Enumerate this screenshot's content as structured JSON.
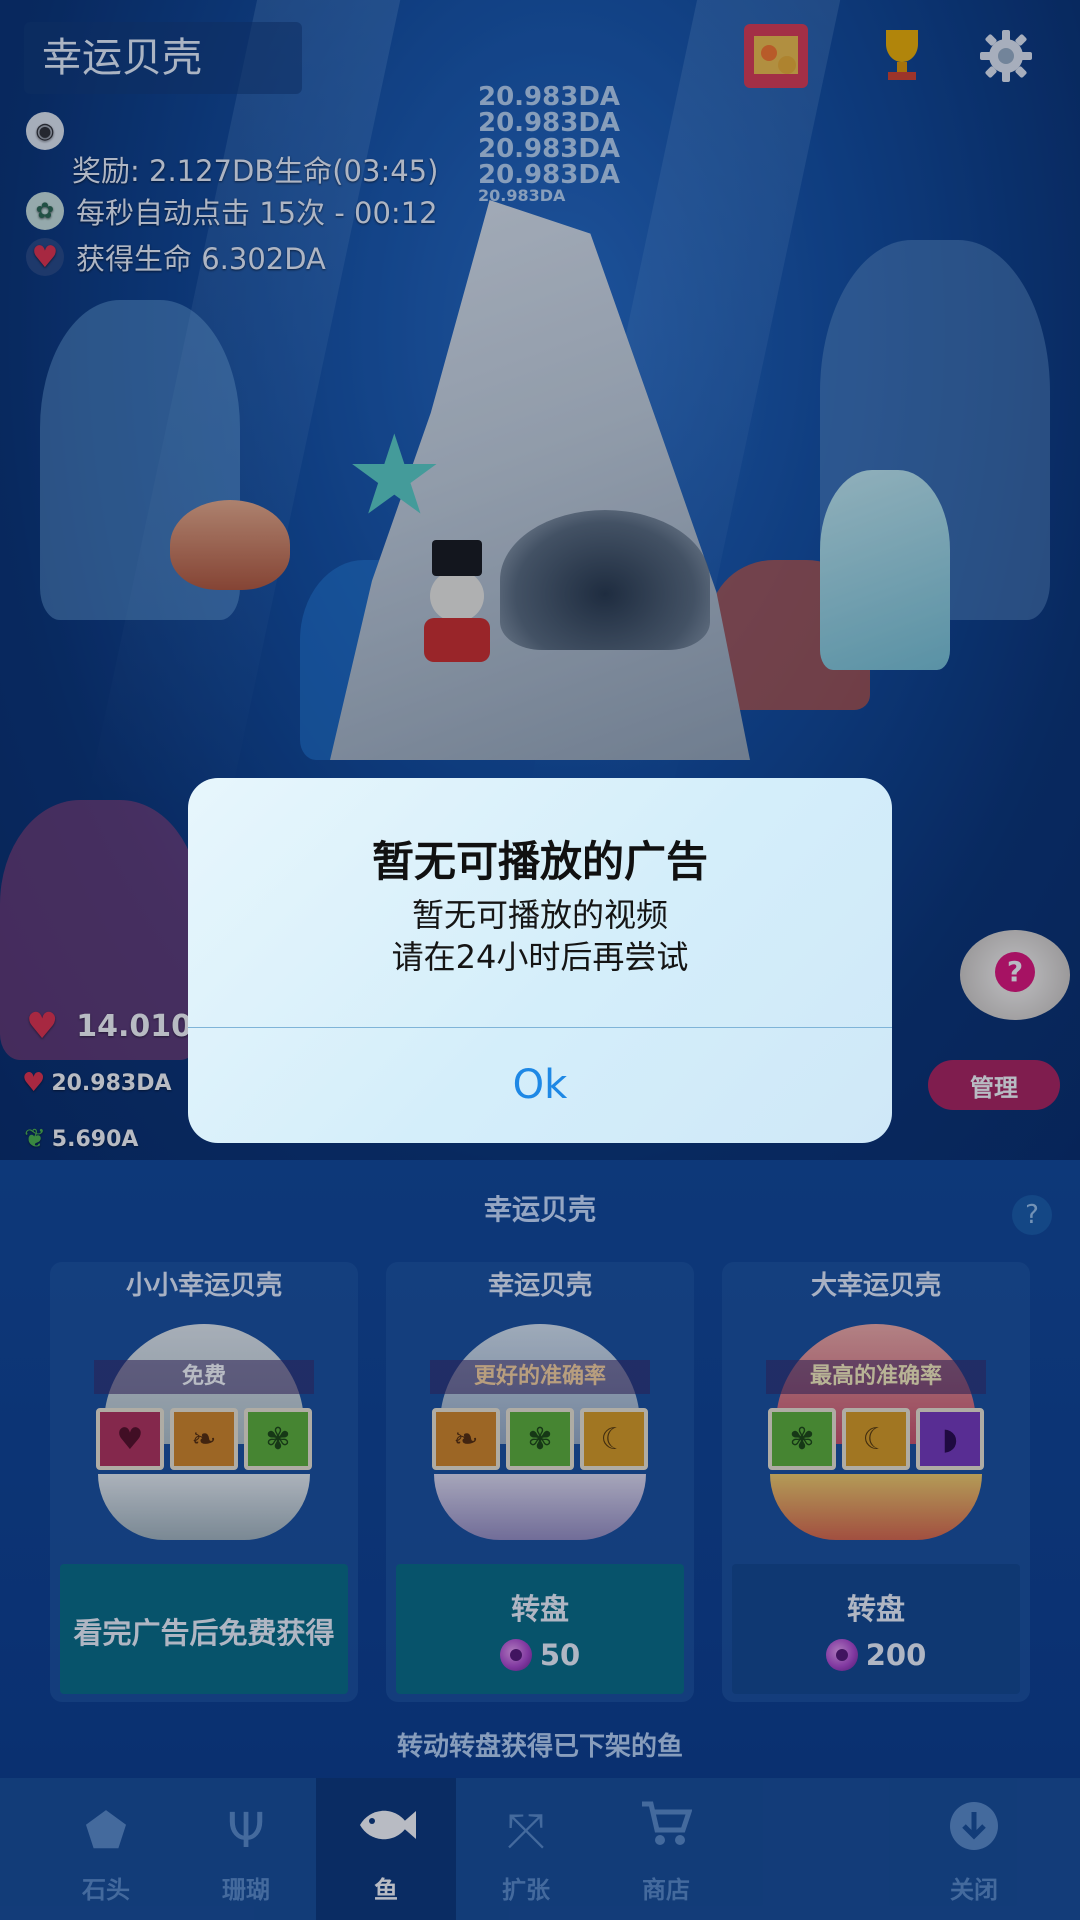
{
  "app": {
    "title": "幸运贝壳"
  },
  "overlay_info": {
    "reward_text": "奖励: 2.127DB生命(03:45)",
    "auto_click_text": "每秒自动点击 15次 - 00:12",
    "life_gain_text": "获得生命 6.302DA",
    "floating_numbers": [
      "20.983DA",
      "20.983DA",
      "20.983DA",
      "20.983DA",
      "20.983DA"
    ]
  },
  "stats": {
    "life_total": "14.010D",
    "per_tap": "20.983DA",
    "seaweed": "5.690A",
    "manage_label": "管理"
  },
  "alert": {
    "title": "暂无可播放的广告",
    "line1": "暂无可播放的视频",
    "line2": "请在24小时后再尝试",
    "ok_label": "Ok"
  },
  "panel": {
    "title": "幸运贝壳",
    "help_label": "?",
    "footer": "转动转盘获得已下架的鱼",
    "cards": [
      {
        "title": "小小幸运贝壳",
        "banner": "免费",
        "slots": [
          "heart-icon",
          "fish-icon",
          "turtle-icon"
        ],
        "button_label": "看完广告后免费获得",
        "price": ""
      },
      {
        "title": "幸运贝壳",
        "banner": "更好的准确率",
        "slots": [
          "fish-icon",
          "turtle-icon",
          "dolphin-icon"
        ],
        "button_label": "转盘",
        "price": "50"
      },
      {
        "title": "大幸运贝壳",
        "banner": "最高的准确率",
        "slots": [
          "turtle-icon",
          "dolphin-icon",
          "whale-icon"
        ],
        "button_label": "转盘",
        "price": "200"
      }
    ]
  },
  "tabs": [
    {
      "label": "石头",
      "icon": "stone-icon",
      "active": false
    },
    {
      "label": "珊瑚",
      "icon": "coral-icon",
      "active": false
    },
    {
      "label": "鱼",
      "icon": "fish-icon",
      "active": true
    },
    {
      "label": "扩张",
      "icon": "expand-icon",
      "active": false
    },
    {
      "label": "商店",
      "icon": "cart-icon",
      "active": false
    },
    {
      "label": "关闭",
      "icon": "close-down-icon",
      "active": false
    }
  ],
  "colors": {
    "accent": "#1e88e5",
    "manage": "#b0245e",
    "card_teal": "#0a6f86",
    "card_navy": "#164a8f",
    "tab_active": "#0f3a7a"
  }
}
